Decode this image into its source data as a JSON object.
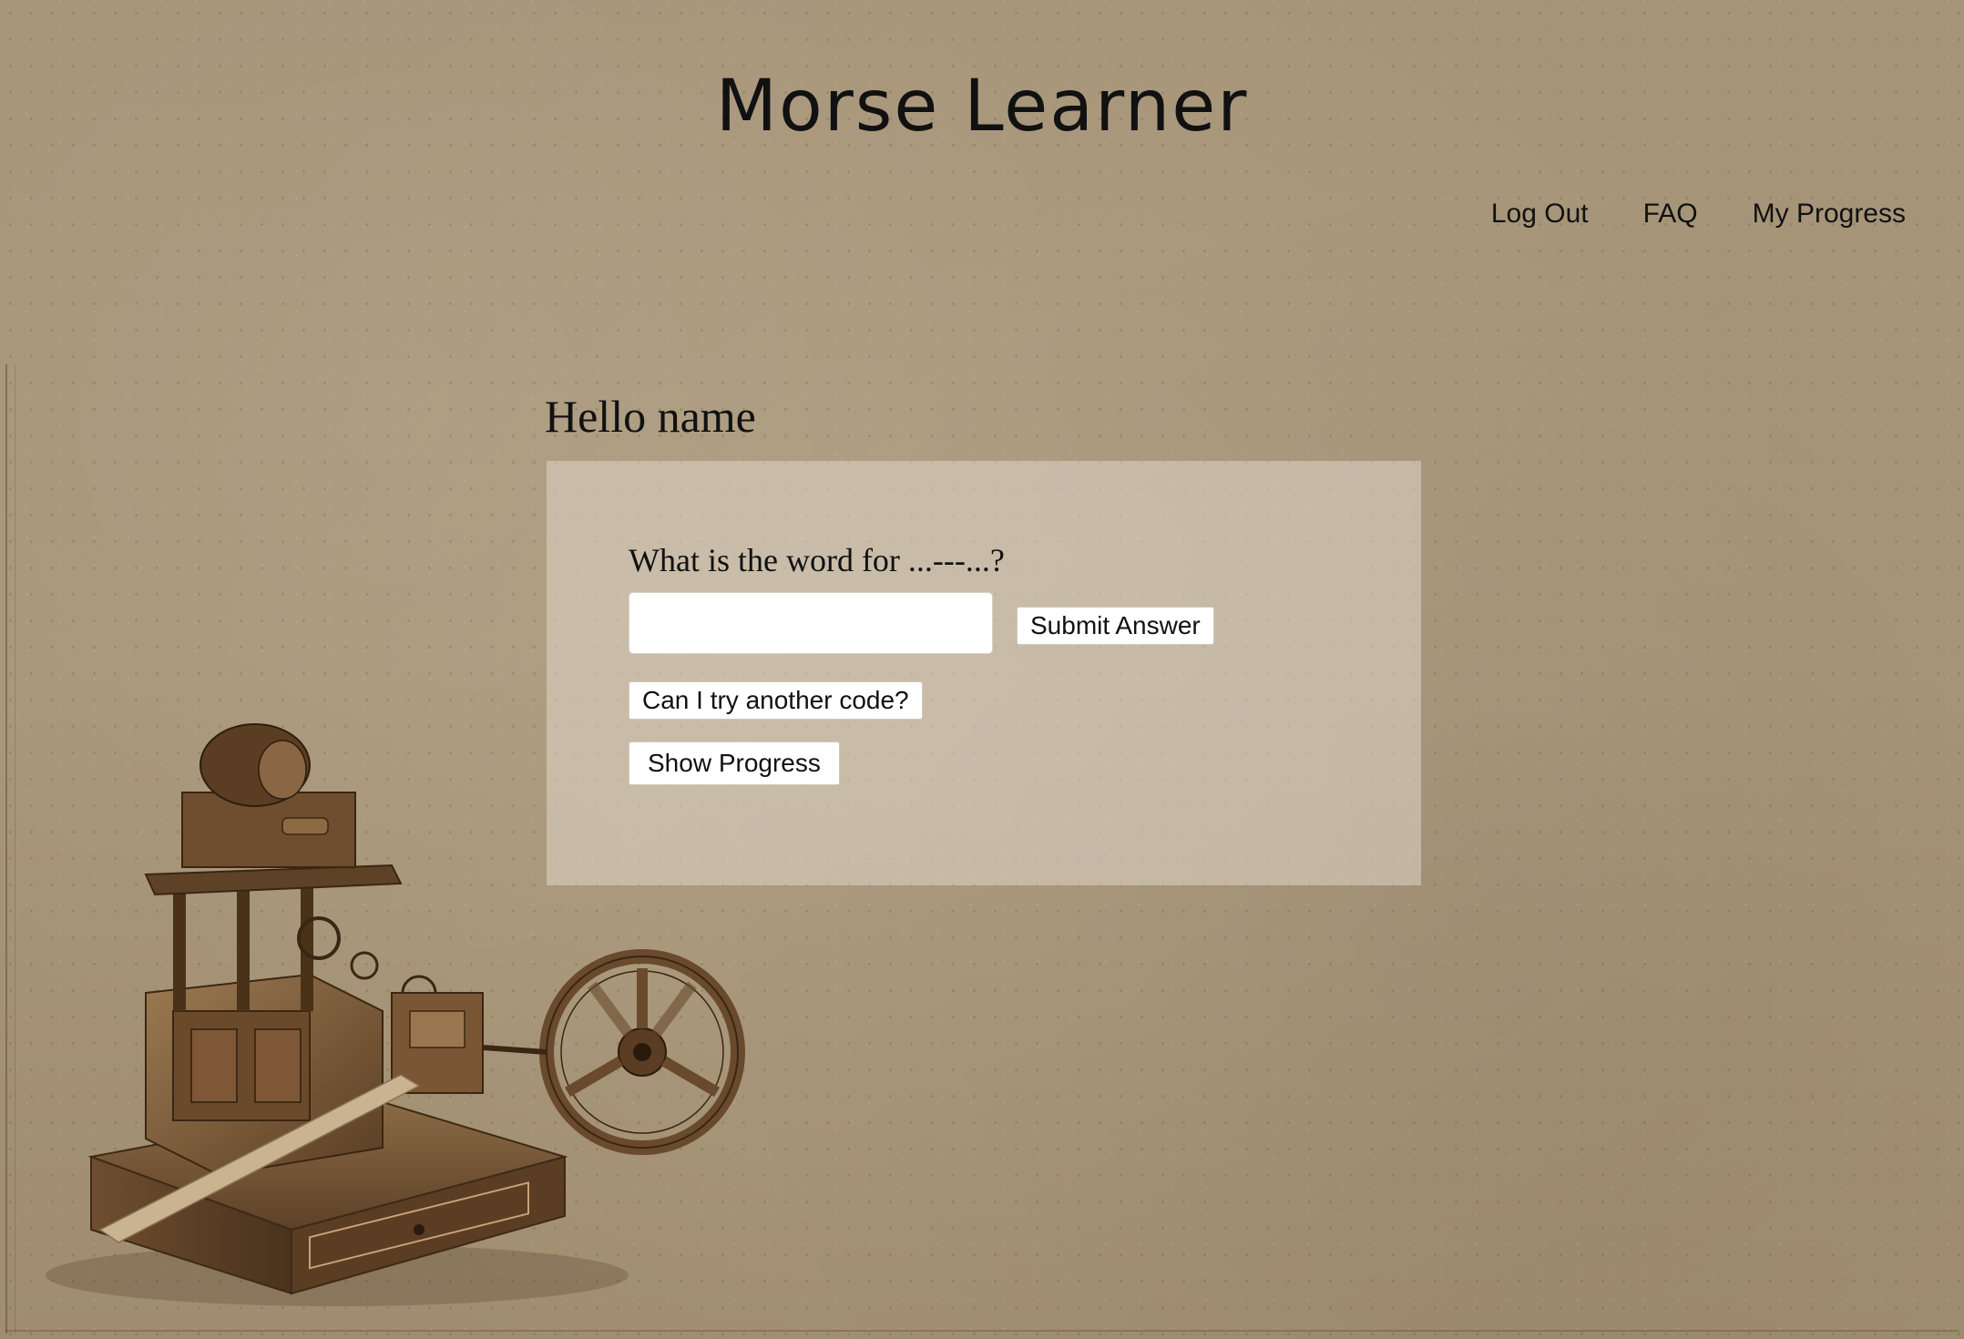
{
  "header": {
    "title": "Morse Learner"
  },
  "nav": {
    "items": [
      {
        "label": "Log Out"
      },
      {
        "label": "FAQ"
      },
      {
        "label": "My Progress"
      }
    ]
  },
  "main": {
    "greeting": "Hello name",
    "quiz": {
      "question": "What is the word for ...---...?",
      "answer_value": "",
      "answer_placeholder": "",
      "submit_label": "Submit Answer",
      "another_code_label": "Can I try another code?",
      "show_progress_label": "Show Progress"
    }
  },
  "decor": {
    "illustration": "telegraph-machine-icon"
  },
  "colors": {
    "background": "#a8967a",
    "panel": "#d4ccbe",
    "text": "#111111"
  }
}
